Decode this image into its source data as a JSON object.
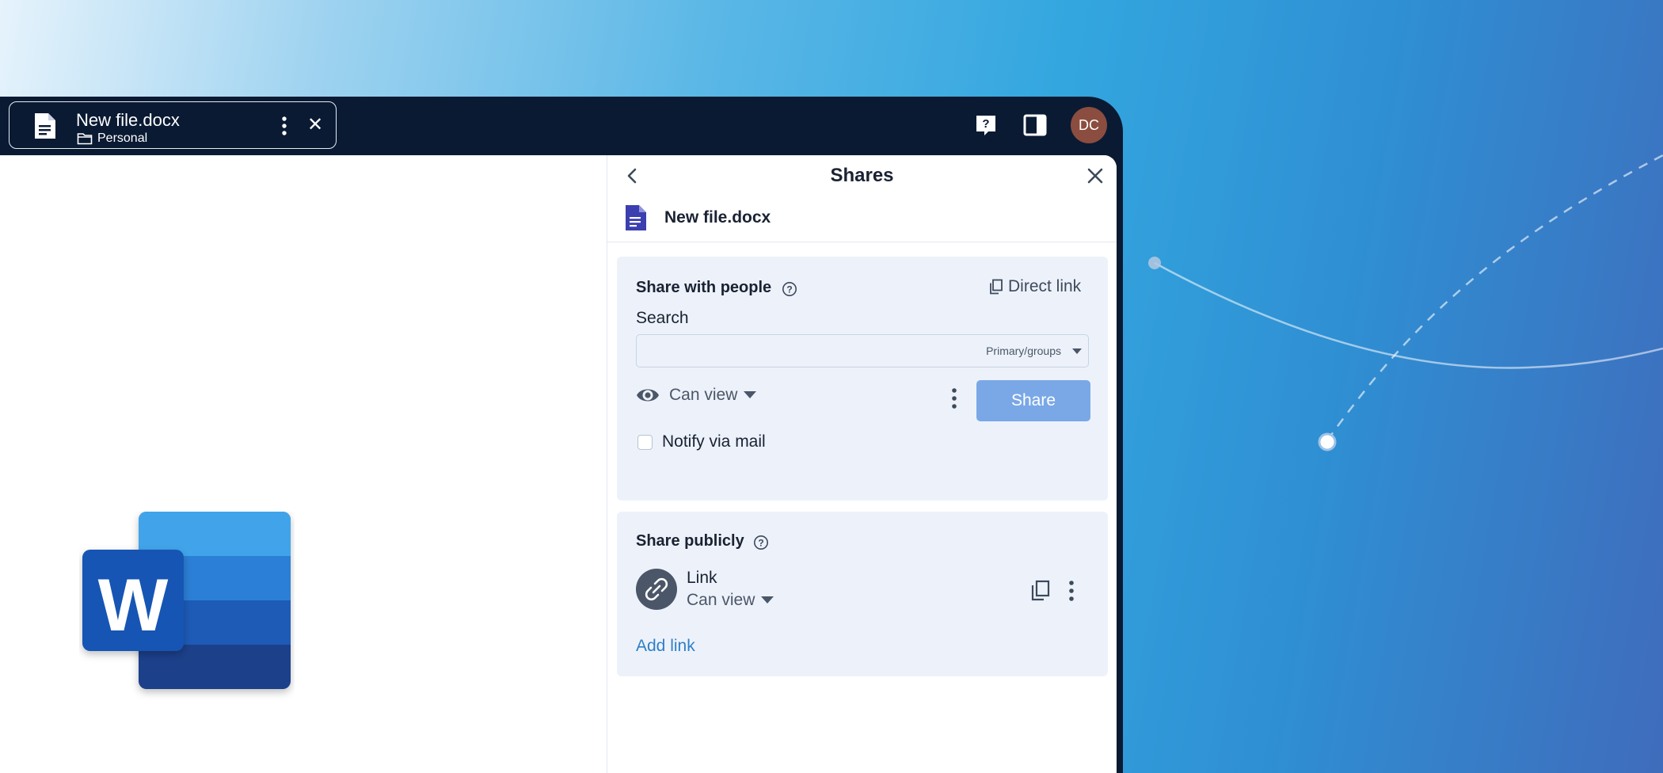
{
  "window": {
    "file_name": "New file.docx",
    "file_folder": "Personal",
    "avatar_initials": "DC"
  },
  "panel": {
    "title": "Shares",
    "file_name": "New file.docx",
    "share_people": {
      "title": "Share with people",
      "direct_link_label": "Direct link",
      "search_label": "Search",
      "search_value": "",
      "search_type": "Primary/groups",
      "permission": "Can view",
      "share_button": "Share",
      "notify_label": "Notify via mail",
      "notify_checked": false
    },
    "share_public": {
      "title": "Share publicly",
      "link_name": "Link",
      "link_permission": "Can view",
      "add_link_label": "Add link"
    }
  },
  "colors": {
    "topbar": "#0a1a33",
    "card_bg": "#edf2fa",
    "share_button": "#7aa8e6",
    "accent_link": "#2f7fc7",
    "avatar": "#8b4d3f"
  },
  "icons": [
    "document-icon",
    "folder-icon",
    "kebab-icon",
    "close-icon",
    "help-icon",
    "sidebar-toggle-icon",
    "back-icon",
    "eye-icon",
    "caret-down-icon",
    "copy-icon",
    "link-icon",
    "word-logo"
  ]
}
